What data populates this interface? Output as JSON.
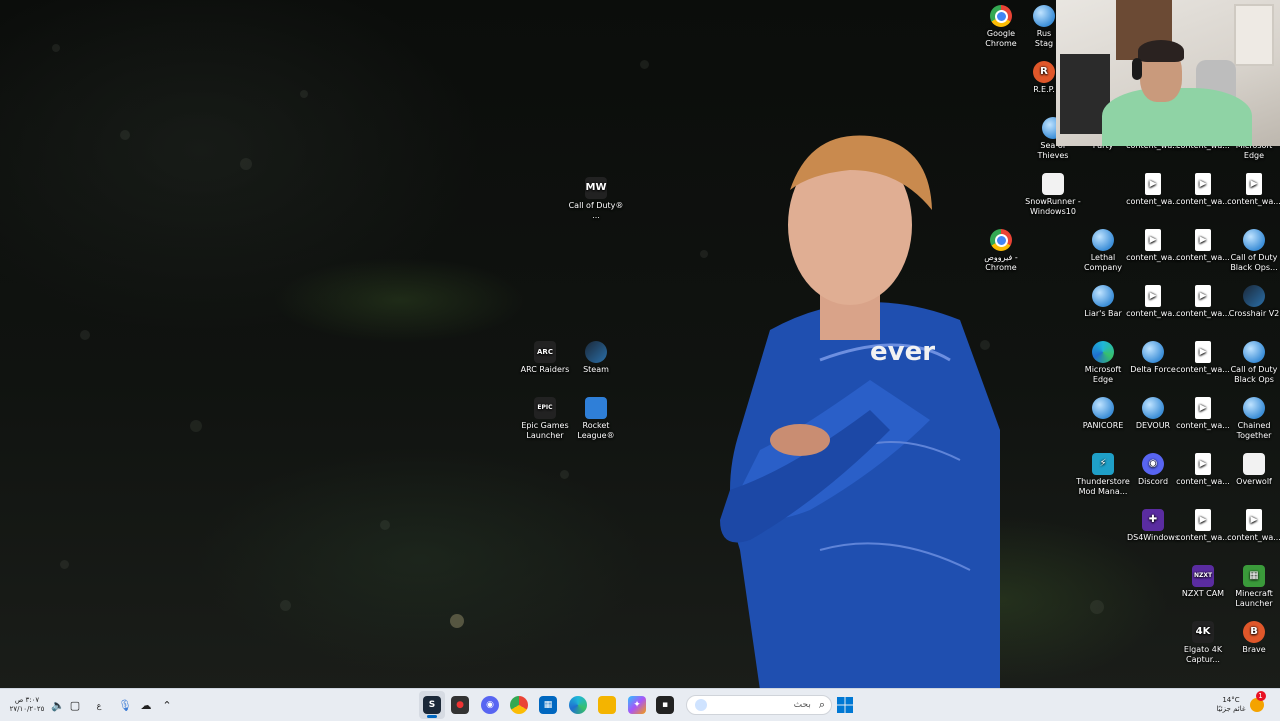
{
  "desktop": {
    "icons": [
      {
        "name": "google-chrome",
        "label": "Google Chrome",
        "glyph": "",
        "style": "ico-chrome"
      },
      {
        "name": "rust-stage",
        "label": "Rus Stag",
        "glyph": "",
        "style": "ico-globe"
      },
      {
        "name": "repo",
        "label": "R.E.P.",
        "glyph": "R",
        "style": "ico-orange"
      },
      {
        "name": "sea-of-thieves",
        "label": "Sea of Thieves",
        "glyph": "",
        "style": "ico-globe"
      },
      {
        "name": "party",
        "label": "Party",
        "glyph": "",
        "style": "ico-globe"
      },
      {
        "name": "content-wa-top-1",
        "label": "content_wa...",
        "glyph": "",
        "style": "ico-globe"
      },
      {
        "name": "content-wa-top-2",
        "label": "content_wa...",
        "glyph": "",
        "style": "ico-globe"
      },
      {
        "name": "microsoft-edge-top",
        "label": "Microsoft Edge",
        "glyph": "",
        "style": "ico-edge"
      },
      {
        "name": "call-of-duty-mid",
        "label": "Call of Duty® ...",
        "glyph": "MW",
        "style": "ico-dark"
      },
      {
        "name": "snowrunner",
        "label": "SnowRunner - Windows10",
        "glyph": "",
        "style": "ico-white"
      },
      {
        "name": "c1-r1-content",
        "label": "content_wa...",
        "glyph": "▶",
        "style": "ico-doc"
      },
      {
        "name": "c2-r1-content",
        "label": "content_wa...",
        "glyph": "▶",
        "style": "ico-doc"
      },
      {
        "name": "c3-r1-content",
        "label": "content_wa...",
        "glyph": "▶",
        "style": "ico-doc"
      },
      {
        "name": "chrome-arabic",
        "label": "فيرووص - Chrome",
        "glyph": "",
        "style": "ico-chrome"
      },
      {
        "name": "lethal-company",
        "label": "Lethal Company",
        "glyph": "",
        "style": "ico-globe"
      },
      {
        "name": "c2-r2-content",
        "label": "content_wa...",
        "glyph": "▶",
        "style": "ico-doc"
      },
      {
        "name": "c3-r2-content",
        "label": "content_wa...",
        "glyph": "▶",
        "style": "ico-doc"
      },
      {
        "name": "cod-black-ops-1",
        "label": "Call of Duty Black Ops...",
        "glyph": "",
        "style": "ico-globe"
      },
      {
        "name": "liars-bar",
        "label": "Liar's Bar",
        "glyph": "",
        "style": "ico-globe"
      },
      {
        "name": "c2-r3-content",
        "label": "content_wa...",
        "glyph": "▶",
        "style": "ico-doc"
      },
      {
        "name": "c3-r3-content",
        "label": "content_wa...",
        "glyph": "▶",
        "style": "ico-doc"
      },
      {
        "name": "crosshair-v2",
        "label": "Crosshair V2",
        "glyph": "",
        "style": "ico-steam"
      },
      {
        "name": "arc-raiders",
        "label": "ARC Raiders",
        "glyph": "ARC",
        "style": "ico-dark"
      },
      {
        "name": "steam",
        "label": "Steam",
        "glyph": "",
        "style": "ico-steam"
      },
      {
        "name": "microsoft-edge",
        "label": "Microsoft Edge",
        "glyph": "",
        "style": "ico-edge"
      },
      {
        "name": "delta-force",
        "label": "Delta Force",
        "glyph": "",
        "style": "ico-globe"
      },
      {
        "name": "c3-r4-content",
        "label": "content_wa...",
        "glyph": "▶",
        "style": "ico-doc"
      },
      {
        "name": "cod-black-ops-2",
        "label": "Call of Duty Black Ops",
        "glyph": "",
        "style": "ico-globe"
      },
      {
        "name": "epic-games",
        "label": "Epic Games Launcher",
        "glyph": "EPIC",
        "style": "ico-dark"
      },
      {
        "name": "rocket-league",
        "label": "Rocket League®",
        "glyph": "",
        "style": "ico-blue"
      },
      {
        "name": "panicore",
        "label": "PANICORE",
        "glyph": "",
        "style": "ico-globe"
      },
      {
        "name": "devour",
        "label": "DEVOUR",
        "glyph": "",
        "style": "ico-globe"
      },
      {
        "name": "c3-r5-content",
        "label": "content_wa...",
        "glyph": "▶",
        "style": "ico-doc"
      },
      {
        "name": "chained-together",
        "label": "Chained Together",
        "glyph": "",
        "style": "ico-globe"
      },
      {
        "name": "thunderstore",
        "label": "Thunderstore Mod Mana...",
        "glyph": "⚡",
        "style": "ico-teal"
      },
      {
        "name": "discord",
        "label": "Discord",
        "glyph": "◉",
        "style": "ico-discord"
      },
      {
        "name": "c3-r6-content",
        "label": "content_wa...",
        "glyph": "▶",
        "style": "ico-doc"
      },
      {
        "name": "overwolf",
        "label": "Overwolf",
        "glyph": "",
        "style": "ico-white"
      },
      {
        "name": "ds4windows",
        "label": "DS4Windows",
        "glyph": "✚",
        "style": "ico-purple"
      },
      {
        "name": "c3-r7-content",
        "label": "content_wa...",
        "glyph": "▶",
        "style": "ico-doc"
      },
      {
        "name": "c4-r7-content",
        "label": "content_wa...",
        "glyph": "▶",
        "style": "ico-doc"
      },
      {
        "name": "nzxt-cam",
        "label": "NZXT CAM",
        "glyph": "NZXT",
        "style": "ico-purple"
      },
      {
        "name": "minecraft-launcher",
        "label": "Minecraft Launcher",
        "glyph": "▦",
        "style": "ico-green"
      },
      {
        "name": "elgato-4k",
        "label": "Elgato 4K Captur...",
        "glyph": "4K",
        "style": "ico-dark"
      },
      {
        "name": "brave",
        "label": "Brave",
        "glyph": "B",
        "style": "ico-orange"
      }
    ]
  },
  "taskbar": {
    "search_placeholder": "بحث",
    "search_icon": "search-icon",
    "start_icon": "windows-start-icon",
    "apps": [
      {
        "name": "steam",
        "glyph": "S",
        "color": "#1b2838",
        "active": true
      },
      {
        "name": "recorder",
        "glyph": "●",
        "color": "#333333",
        "active": false
      },
      {
        "name": "discord",
        "glyph": "◉",
        "color": "#5865f2",
        "active": false
      },
      {
        "name": "chrome",
        "glyph": "◍",
        "color": "#34a853",
        "active": false
      },
      {
        "name": "store",
        "glyph": "▦",
        "color": "#0067c0",
        "active": false
      },
      {
        "name": "edge",
        "glyph": "e",
        "color": "#1fb7d8",
        "active": false
      },
      {
        "name": "file-explorer",
        "glyph": "▭",
        "color": "#f4b400",
        "active": false
      },
      {
        "name": "copilot",
        "glyph": "✦",
        "color": "#8a5cf6",
        "active": false
      },
      {
        "name": "terminal",
        "glyph": "▪",
        "color": "#222222",
        "active": false
      }
    ],
    "tray": {
      "time": "٣:٠٧ ص",
      "date": "٢٧/١٠/٢٠٢٥",
      "weather_temp": "14°C",
      "weather_desc": "غائم جزئيًا",
      "notification_count": "1"
    }
  },
  "colors": {
    "taskbar_bg": "#e8ecf2",
    "accent": "#0067c0",
    "jersey_blue": "#1f4fb0"
  }
}
